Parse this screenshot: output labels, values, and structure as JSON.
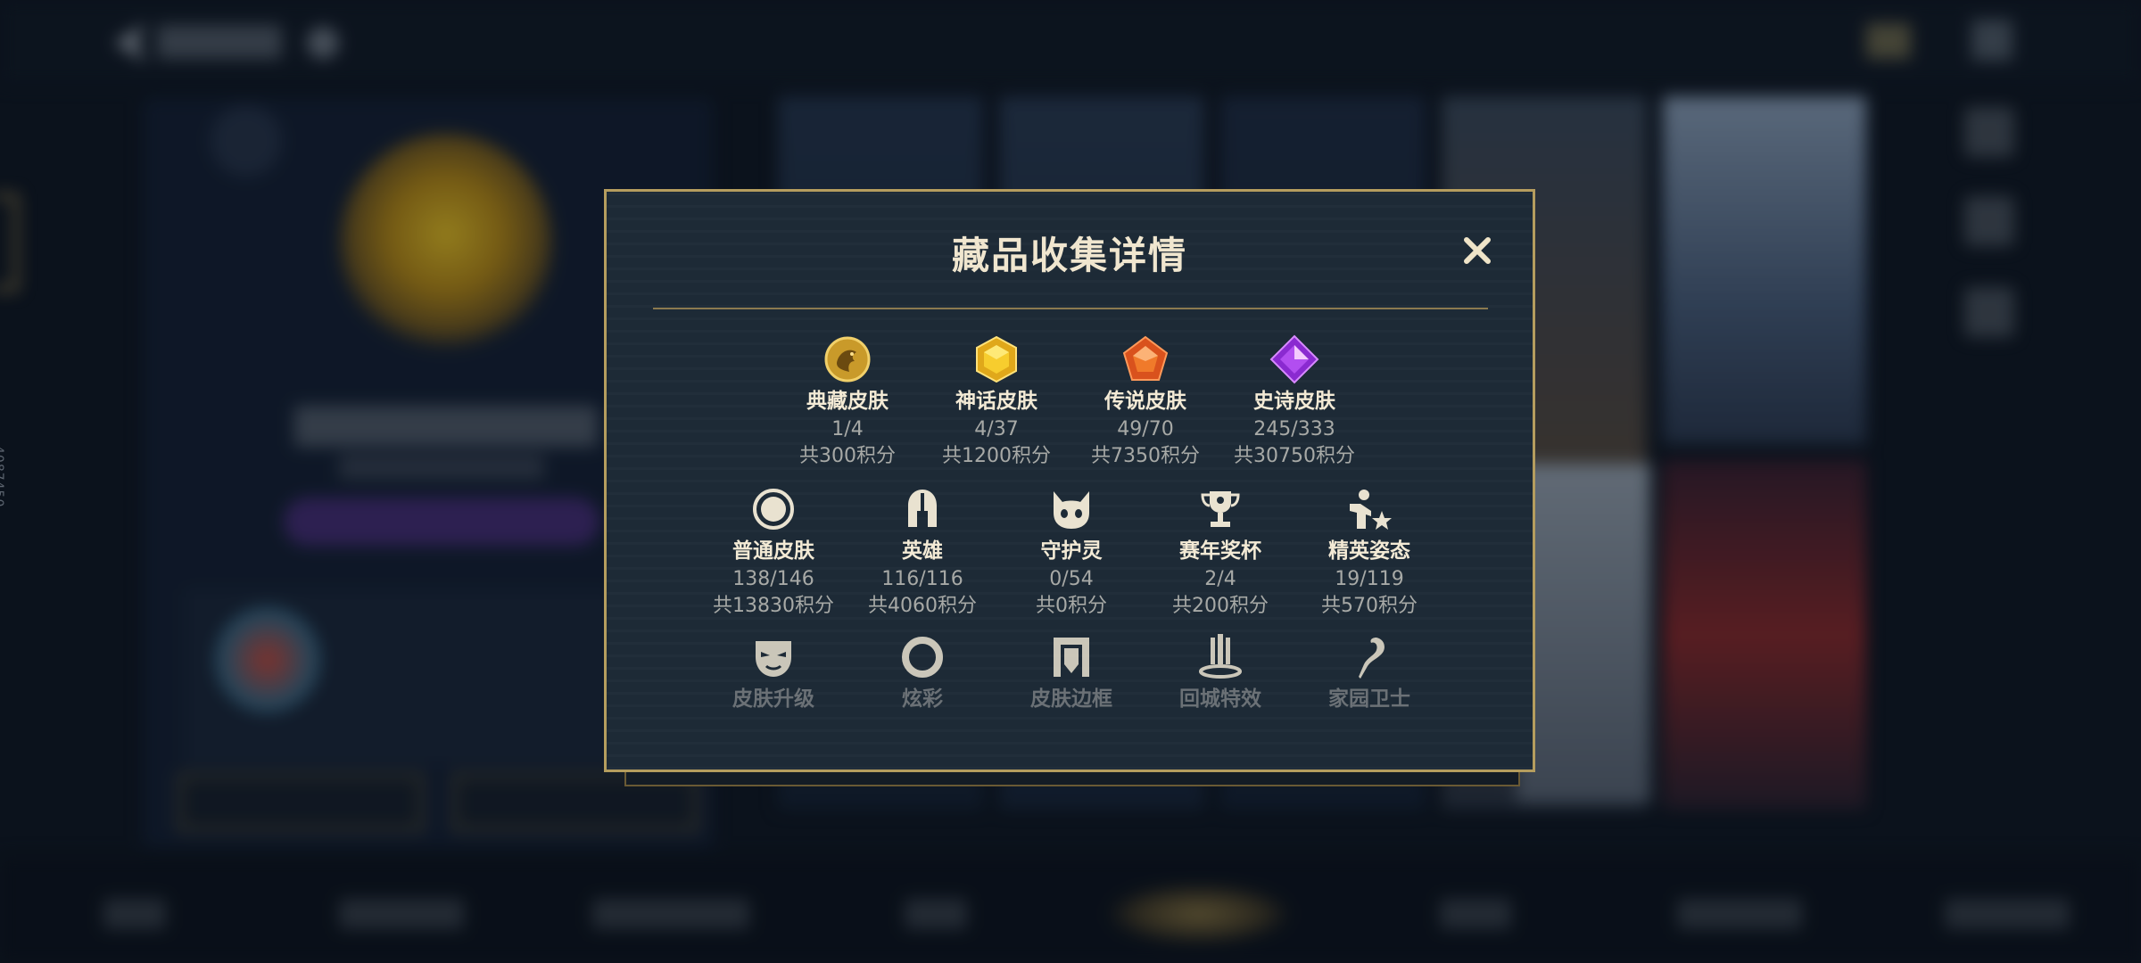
{
  "background": {
    "side_id": "4087450"
  },
  "modal": {
    "title": "藏品收集详情",
    "close_icon": "close-icon",
    "row1": [
      {
        "icon": "dragon-emblem-icon",
        "label": "典藏皮肤",
        "count": "1/4",
        "points": "共300积分"
      },
      {
        "icon": "gold-hexagon-gem-icon",
        "label": "神话皮肤",
        "count": "4/37",
        "points": "共1200积分"
      },
      {
        "icon": "orange-pentagon-gem-icon",
        "label": "传说皮肤",
        "count": "49/70",
        "points": "共7350积分"
      },
      {
        "icon": "purple-diamond-gem-icon",
        "label": "史诗皮肤",
        "count": "245/333",
        "points": "共30750积分"
      }
    ],
    "row2": [
      {
        "icon": "ring-circle-icon",
        "label": "普通皮肤",
        "count": "138/146",
        "points": "共13830积分"
      },
      {
        "icon": "helmet-icon",
        "label": "英雄",
        "count": "116/116",
        "points": "共4060积分"
      },
      {
        "icon": "guardian-spirit-icon",
        "label": "守护灵",
        "count": "0/54",
        "points": "共0积分"
      },
      {
        "icon": "trophy-icon",
        "label": "赛年奖杯",
        "count": "2/4",
        "points": "共200积分"
      },
      {
        "icon": "elite-pose-icon",
        "label": "精英姿态",
        "count": "19/119",
        "points": "共570积分"
      }
    ],
    "row3": [
      {
        "icon": "mask-icon",
        "label": "皮肤升级"
      },
      {
        "icon": "ring-icon",
        "label": "炫彩"
      },
      {
        "icon": "skin-frame-icon",
        "label": "皮肤边框"
      },
      {
        "icon": "recall-effect-icon",
        "label": "回城特效"
      },
      {
        "icon": "home-guard-icon",
        "label": "家园卫士"
      }
    ]
  },
  "colors": {
    "gold": "#b59d5e",
    "panel": "#1d2a36",
    "text_primary": "#f3ead5",
    "text_secondary": "#a7a9a6"
  }
}
